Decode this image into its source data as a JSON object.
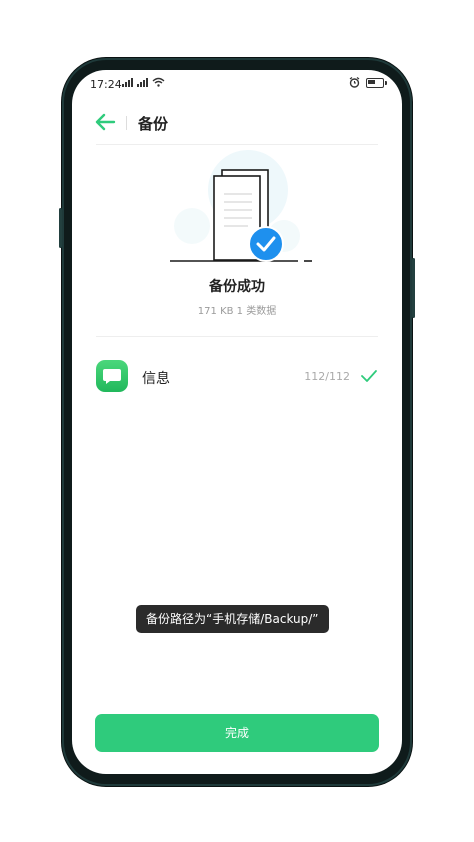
{
  "status_bar": {
    "time": "17:24",
    "icons": [
      "signal-icon",
      "signal-icon",
      "wifi-icon",
      "alarm-icon",
      "battery-icon"
    ]
  },
  "app_bar": {
    "title": "备份",
    "back_icon": "arrow-left-icon"
  },
  "result": {
    "title": "备份成功",
    "subtitle": "171 KB  1 类数据",
    "illustration_icon": "document-check-icon"
  },
  "items": [
    {
      "label": "信息",
      "count": "112/112",
      "icon": "message-icon",
      "status_icon": "check-icon"
    }
  ],
  "toast": {
    "text": "备份路径为“手机存储/Backup/”"
  },
  "footer": {
    "done_label": "完成"
  },
  "colors": {
    "accent": "#2fcb7c",
    "check_blue": "#1e90ee",
    "message_green": "#27bd63",
    "frame": "#0f1b1b"
  }
}
